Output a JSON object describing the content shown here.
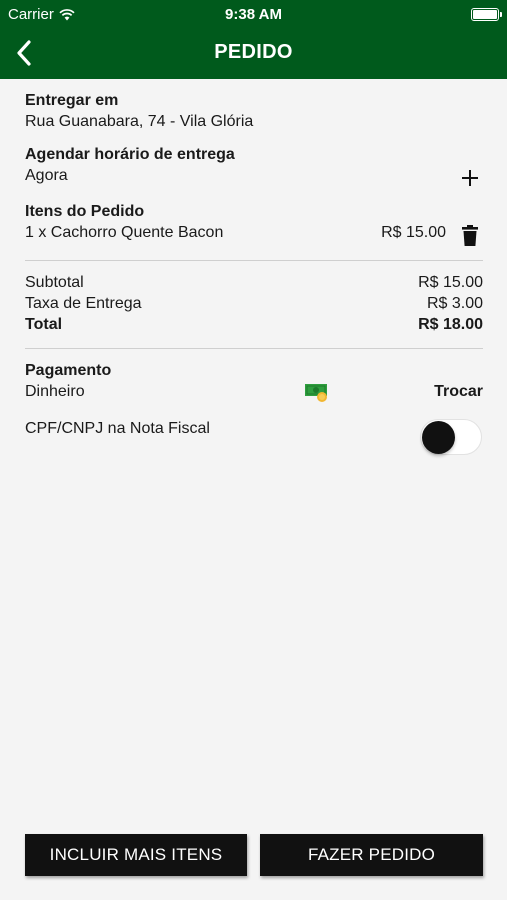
{
  "status_bar": {
    "carrier": "Carrier",
    "time": "9:38 AM"
  },
  "nav": {
    "title": "PEDIDO"
  },
  "delivery": {
    "label": "Entregar em",
    "address": "Rua Guanabara, 74 - Vila Glória"
  },
  "schedule": {
    "label": "Agendar horário de entrega",
    "value": "Agora"
  },
  "items": {
    "label": "Itens do Pedido",
    "list": [
      {
        "description": "1 x Cachorro Quente Bacon",
        "price": "R$ 15.00"
      }
    ]
  },
  "totals": {
    "subtotal_label": "Subtotal",
    "subtotal_value": "R$ 15.00",
    "fee_label": "Taxa de Entrega",
    "fee_value": "R$ 3.00",
    "total_label": "Total",
    "total_value": "R$ 18.00"
  },
  "payment": {
    "label": "Pagamento",
    "method": "Dinheiro",
    "change_label": "Trocar",
    "method_icon": "cash-icon"
  },
  "tax_id": {
    "label": "CPF/CNPJ na Nota Fiscal",
    "enabled": false
  },
  "buttons": {
    "add_more": "INCLUIR MAIS ITENS",
    "place_order": "FAZER PEDIDO"
  },
  "colors": {
    "header": "#005a1c",
    "button": "#111111",
    "background": "#f4f4f4"
  }
}
